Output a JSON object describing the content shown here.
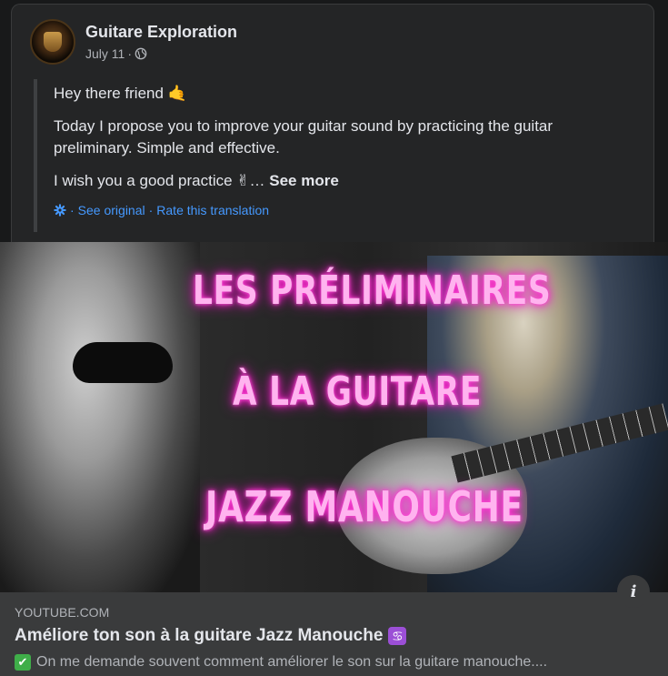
{
  "post": {
    "page_name": "Guitare Exploration",
    "date": "July 11",
    "separator": "·",
    "line1": "Hey there friend 🤙",
    "line2": "Today I propose you to improve your guitar sound by practicing the guitar preliminary. Simple and effective.",
    "line3": "I wish you a good practice ✌…",
    "see_more": "See more",
    "see_original": "See original",
    "rate_translation": "Rate this translation",
    "dot": "·"
  },
  "thumbnail": {
    "neon_line1": "LES PRÉLIMINAIRES",
    "neon_line2": "À LA GUITARE",
    "neon_line3": "JAZZ MANOUCHE",
    "info_icon": "i"
  },
  "link_preview": {
    "domain": "YOUTUBE.COM",
    "title": "Améliore ton son à la guitare Jazz Manouche",
    "title_icon": "♋",
    "description": "On me demande souvent comment améliorer le son sur la guitare manouche....",
    "description_icon": "✔"
  },
  "colors": {
    "background": "#18191a",
    "card": "#242526",
    "link_blue": "#4599ff",
    "neon_pink": "#ff2bd0"
  }
}
